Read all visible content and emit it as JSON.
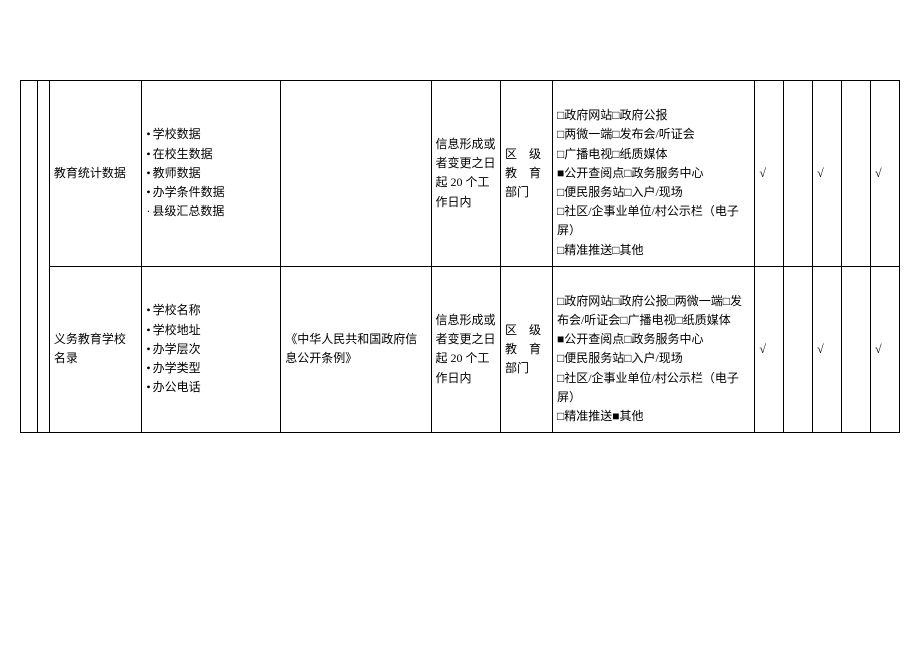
{
  "rows": [
    {
      "name": "教育统计数据",
      "content_items": [
        "学校数据",
        "在校生数据",
        "教师数据",
        "办学条件数据",
        "县级汇总数据"
      ],
      "basis": "",
      "time": "信息形成或者变更之日起 20 个工作日内",
      "subject": "区　级教　育部门",
      "channels": "□政府网站□政府公报\n□两微一端□发布会/听证会\n□广播电视□纸质媒体\n■公开查阅点□政务服务中心\n□便民服务站□入户/现场\n□社区/企事业单位/村公示栏（电子屏）\n□精准推送□其他",
      "checks": [
        "√",
        "",
        "√",
        "",
        "√"
      ]
    },
    {
      "name": "义务教育学校名录",
      "content_items": [
        "学校名称",
        "学校地址",
        "办学层次",
        "办学类型",
        "办公电话"
      ],
      "basis": "《中华人民共和国政府信息公开条例》",
      "time": "信息形成或者变更之日起 20 个工作日内",
      "subject": "区　级教　育部门",
      "channels": "□政府网站□政府公报□两微一端□发布会/听证会□广播电视□纸质媒体\n■公开查阅点□政务服务中心\n□便民服务站□入户/现场\n□社区/企事业单位/村公示栏（电子屏）\n□精准推送■其他",
      "checks": [
        "√",
        "",
        "√",
        "",
        "√"
      ]
    }
  ]
}
